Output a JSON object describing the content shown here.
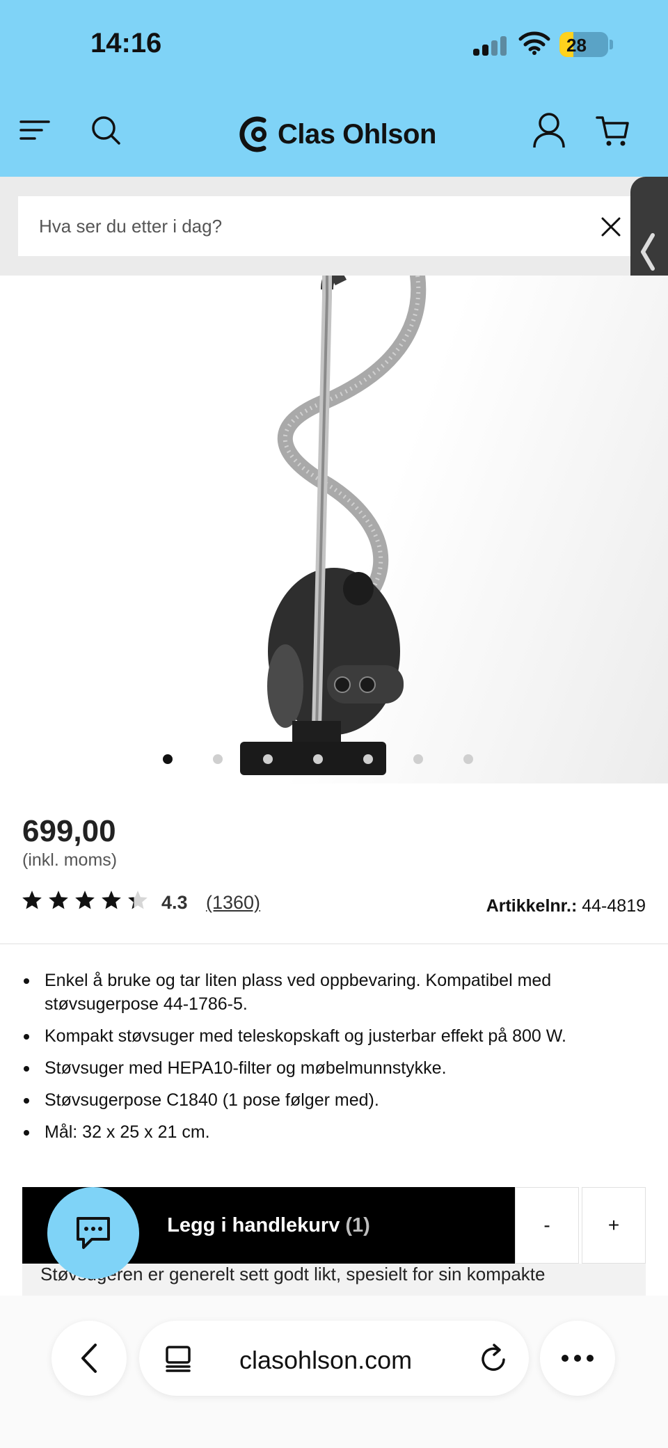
{
  "status_bar": {
    "time": "14:16",
    "battery": "28",
    "battery_level": 0.28
  },
  "header": {
    "brand": "Clas Ohlson"
  },
  "search": {
    "placeholder": "Hva ser du etter i dag?"
  },
  "gallery": {
    "total_images": 7,
    "active_index": 0
  },
  "product": {
    "price": "699,00",
    "vat_note": "(inkl. moms)",
    "rating": "4.3",
    "rating_stars": 4.3,
    "review_count": "(1360)",
    "article_label": "Artikkelnr.:",
    "article_number": "44-4819",
    "bullets": [
      "Enkel å bruke og tar liten plass ved oppbevaring. Kompatibel med støvsugerpose 44-1786-5.",
      "Kompakt støvsuger med teleskopskaft og justerbar effekt på 800 W.",
      "Støvsuger med HEPA10-filter og møbelmunnstykke.",
      "Støvsugerpose C1840 (1 pose følger med).",
      "Mål: 32 x 25 x 21 cm."
    ]
  },
  "cart": {
    "add_label": "Legg i handlekurv",
    "quantity": "(1)",
    "minus": "-",
    "plus": "+"
  },
  "review_summary": "Støvsugeren er generelt sett godt likt, spesielt for sin kompakte",
  "browser": {
    "url": "clasohlson.com"
  },
  "colors": {
    "header_bg": "#7fd3f7",
    "button_bg": "#000000",
    "chat_bg": "#7fd3f7"
  }
}
